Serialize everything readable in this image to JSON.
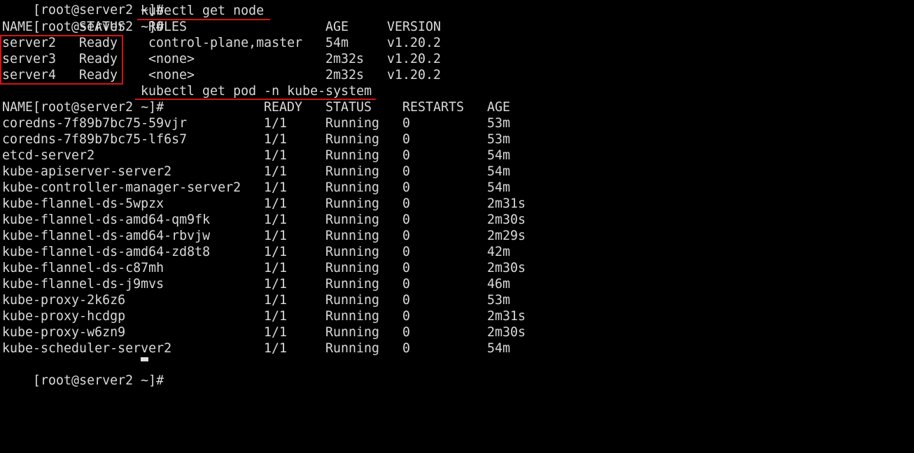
{
  "terminal": {
    "top_cutoff_fragment": "[root@server2 ~]#          ",
    "cmd1": {
      "prompt": "[root@server2 ~]#",
      "command": "kubectl get node"
    },
    "nodes": {
      "headers": [
        "NAME",
        "STATUS",
        "ROLES",
        "AGE",
        "VERSION"
      ],
      "rows": [
        [
          "server2",
          "Ready",
          "control-plane,master",
          "54m",
          "v1.20.2"
        ],
        [
          "server3",
          "Ready",
          "<none>",
          "2m32s",
          "v1.20.2"
        ],
        [
          "server4",
          "Ready",
          "<none>",
          "2m32s",
          "v1.20.2"
        ]
      ]
    },
    "cmd2": {
      "prompt": "[root@server2 ~]#",
      "command": "kubectl get pod -n kube-system"
    },
    "pods": {
      "headers": [
        "NAME",
        "READY",
        "STATUS",
        "RESTARTS",
        "AGE"
      ],
      "rows": [
        [
          "coredns-7f89b7bc75-59vjr",
          "1/1",
          "Running",
          "0",
          "53m"
        ],
        [
          "coredns-7f89b7bc75-lf6s7",
          "1/1",
          "Running",
          "0",
          "53m"
        ],
        [
          "etcd-server2",
          "1/1",
          "Running",
          "0",
          "54m"
        ],
        [
          "kube-apiserver-server2",
          "1/1",
          "Running",
          "0",
          "54m"
        ],
        [
          "kube-controller-manager-server2",
          "1/1",
          "Running",
          "0",
          "54m"
        ],
        [
          "kube-flannel-ds-5wpzx",
          "1/1",
          "Running",
          "0",
          "2m31s"
        ],
        [
          "kube-flannel-ds-amd64-qm9fk",
          "1/1",
          "Running",
          "0",
          "2m30s"
        ],
        [
          "kube-flannel-ds-amd64-rbvjw",
          "1/1",
          "Running",
          "0",
          "2m29s"
        ],
        [
          "kube-flannel-ds-amd64-zd8t8",
          "1/1",
          "Running",
          "0",
          "42m"
        ],
        [
          "kube-flannel-ds-c87mh",
          "1/1",
          "Running",
          "0",
          "2m30s"
        ],
        [
          "kube-flannel-ds-j9mvs",
          "1/1",
          "Running",
          "0",
          "46m"
        ],
        [
          "kube-proxy-2k6z6",
          "1/1",
          "Running",
          "0",
          "53m"
        ],
        [
          "kube-proxy-hcdgp",
          "1/1",
          "Running",
          "0",
          "2m31s"
        ],
        [
          "kube-proxy-w6zn9",
          "1/1",
          "Running",
          "0",
          "2m30s"
        ],
        [
          "kube-scheduler-server2",
          "1/1",
          "Running",
          "0",
          "54m"
        ]
      ]
    },
    "final_prompt": "[root@server2 ~]#"
  },
  "colors": {
    "background": "#000000",
    "text": "#d9d9d9",
    "annotation": "#d21414"
  }
}
